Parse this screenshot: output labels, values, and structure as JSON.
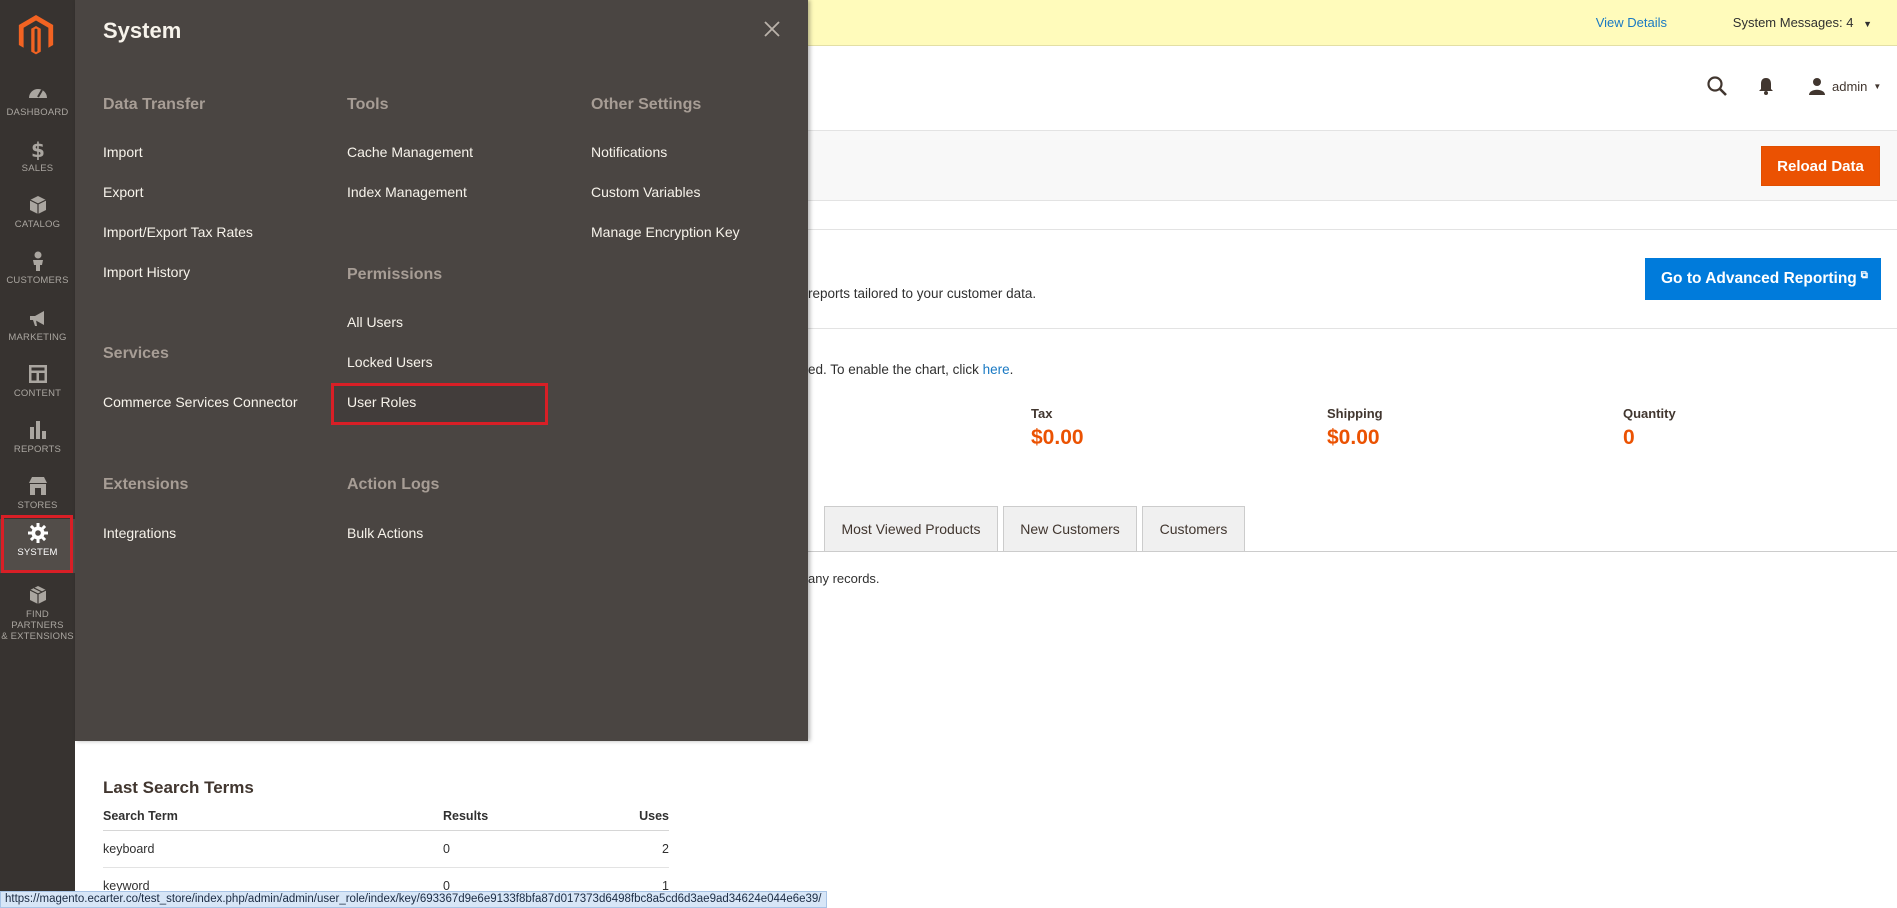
{
  "sidebar": {
    "items": [
      {
        "label": "DASHBOARD",
        "icon": "dashboard-icon"
      },
      {
        "label": "SALES",
        "icon": "dollar-icon"
      },
      {
        "label": "CATALOG",
        "icon": "box-icon"
      },
      {
        "label": "CUSTOMERS",
        "icon": "person-icon"
      },
      {
        "label": "MARKETING",
        "icon": "megaphone-icon"
      },
      {
        "label": "CONTENT",
        "icon": "content-icon"
      },
      {
        "label": "REPORTS",
        "icon": "bar-chart-icon"
      },
      {
        "label": "STORES",
        "icon": "store-icon"
      },
      {
        "label": "SYSTEM",
        "icon": "gear-icon"
      },
      {
        "label_line1": "FIND PARTNERS",
        "label_line2": "& EXTENSIONS",
        "icon": "extensions-box-icon"
      }
    ]
  },
  "messages": {
    "view_details": "View Details",
    "system_messages": "System Messages: 4"
  },
  "header": {
    "user": "admin"
  },
  "actions": {
    "reload": "Reload Data"
  },
  "advanced_reporting": {
    "text": "reports tailored to your customer data.",
    "button": "Go to Advanced Reporting"
  },
  "chart_note": {
    "text": "ed. To enable the chart, click ",
    "link": "here",
    "end": "."
  },
  "totals": [
    {
      "label": "Tax",
      "value": "$0.00"
    },
    {
      "label": "Shipping",
      "value": "$0.00"
    },
    {
      "label": "Quantity",
      "value": "0"
    }
  ],
  "tabs": [
    "Most Viewed Products",
    "New Customers",
    "Customers"
  ],
  "no_records": "any records.",
  "last_search": {
    "title": "Last Search Terms",
    "headers": [
      "Search Term",
      "Results",
      "Uses"
    ],
    "rows": [
      [
        "keyboard",
        "0",
        "2"
      ],
      [
        "keyword",
        "0",
        "1"
      ]
    ]
  },
  "status_url": "https://magento.ecarter.co/test_store/index.php/admin/admin/user_role/index/key/693367d9e6e9133f8bfa87d017373d6498fbc8a5cd6d3ae9ad34624e044e6e39/",
  "menu": {
    "title": "System",
    "col1": {
      "data_transfer": "Data Transfer",
      "import": "Import",
      "export": "Export",
      "tax_rates": "Import/Export Tax Rates",
      "import_history": "Import History",
      "services": "Services",
      "connector": "Commerce Services Connector",
      "extensions": "Extensions",
      "integrations": "Integrations"
    },
    "col2": {
      "tools": "Tools",
      "cache": "Cache Management",
      "index": "Index Management",
      "permissions": "Permissions",
      "all_users": "All Users",
      "locked_users": "Locked Users",
      "user_roles": "User Roles",
      "action_logs": "Action Logs",
      "bulk_actions": "Bulk Actions"
    },
    "col3": {
      "other_settings": "Other Settings",
      "notifications": "Notifications",
      "custom_variables": "Custom Variables",
      "encryption_key": "Manage Encryption Key"
    }
  },
  "colors": {
    "sidebar_bg": "#373330",
    "menu_bg": "#4a4542",
    "accent_orange": "#eb5202",
    "accent_blue": "#007bdb",
    "highlight_red": "#d81f26"
  }
}
